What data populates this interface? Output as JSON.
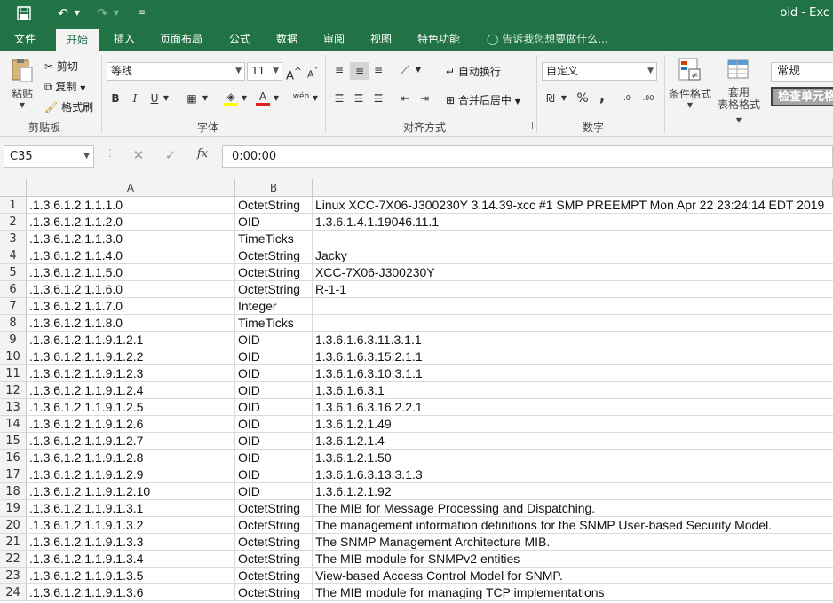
{
  "app": {
    "title": "oid - Exc",
    "accent_color": "#217346",
    "quick_access": [
      "save-icon",
      "undo-icon",
      "redo-icon",
      "customize-icon"
    ]
  },
  "tabs": [
    "文件",
    "开始",
    "插入",
    "页面布局",
    "公式",
    "数据",
    "审阅",
    "视图",
    "特色功能"
  ],
  "active_tab": "开始",
  "tell_me": "告诉我您想要做什么...",
  "ribbon": {
    "clipboard": {
      "paste": "粘贴",
      "cut": "剪切",
      "copy": "复制",
      "format_painter": "格式刷",
      "label": "剪贴板"
    },
    "font": {
      "name": "等线",
      "size": "11",
      "bold": "B",
      "italic": "I",
      "underline": "U",
      "grow": "A",
      "shrink": "A",
      "phonetic": "wén",
      "label": "字体"
    },
    "alignment": {
      "wrap": "自动换行",
      "merge": "合并后居中",
      "label": "对齐方式"
    },
    "number": {
      "format": "自定义",
      "percent": "%",
      "comma": ",",
      "label": "数字"
    },
    "styles": {
      "conditional": "条件格式",
      "table_line1": "套用",
      "table_line2": "表格格式",
      "style_normal": "常规",
      "style_check": "检查单元格"
    }
  },
  "formula_bar": {
    "name_box": "C35",
    "cancel": "✕",
    "enter": "✓",
    "fx": "fx",
    "content": "0:00:00"
  },
  "columns": [
    "A",
    "B"
  ],
  "rows": [
    {
      "num": "1",
      "a": ".1.3.6.1.2.1.1.1.0",
      "b": "OctetString",
      "c": "Linux XCC-7X06-J300230Y 3.14.39-xcc #1 SMP PREEMPT Mon Apr 22 23:24:14 EDT 2019"
    },
    {
      "num": "2",
      "a": ".1.3.6.1.2.1.1.2.0",
      "b": "OID",
      "c": "1.3.6.1.4.1.19046.11.1"
    },
    {
      "num": "3",
      "a": ".1.3.6.1.2.1.1.3.0",
      "b": "TimeTicks",
      "c": ""
    },
    {
      "num": "4",
      "a": ".1.3.6.1.2.1.1.4.0",
      "b": "OctetString",
      "c": "Jacky"
    },
    {
      "num": "5",
      "a": ".1.3.6.1.2.1.1.5.0",
      "b": "OctetString",
      "c": "XCC-7X06-J300230Y"
    },
    {
      "num": "6",
      "a": ".1.3.6.1.2.1.1.6.0",
      "b": "OctetString",
      "c": "R-1-1"
    },
    {
      "num": "7",
      "a": ".1.3.6.1.2.1.1.7.0",
      "b": "Integer",
      "c": ""
    },
    {
      "num": "8",
      "a": ".1.3.6.1.2.1.1.8.0",
      "b": "TimeTicks",
      "c": ""
    },
    {
      "num": "9",
      "a": ".1.3.6.1.2.1.1.9.1.2.1",
      "b": "OID",
      "c": "1.3.6.1.6.3.11.3.1.1"
    },
    {
      "num": "10",
      "a": ".1.3.6.1.2.1.1.9.1.2.2",
      "b": "OID",
      "c": "1.3.6.1.6.3.15.2.1.1"
    },
    {
      "num": "11",
      "a": ".1.3.6.1.2.1.1.9.1.2.3",
      "b": "OID",
      "c": "1.3.6.1.6.3.10.3.1.1"
    },
    {
      "num": "12",
      "a": ".1.3.6.1.2.1.1.9.1.2.4",
      "b": "OID",
      "c": "1.3.6.1.6.3.1"
    },
    {
      "num": "13",
      "a": ".1.3.6.1.2.1.1.9.1.2.5",
      "b": "OID",
      "c": "1.3.6.1.6.3.16.2.2.1"
    },
    {
      "num": "14",
      "a": ".1.3.6.1.2.1.1.9.1.2.6",
      "b": "OID",
      "c": "1.3.6.1.2.1.49"
    },
    {
      "num": "15",
      "a": ".1.3.6.1.2.1.1.9.1.2.7",
      "b": "OID",
      "c": "1.3.6.1.2.1.4"
    },
    {
      "num": "16",
      "a": ".1.3.6.1.2.1.1.9.1.2.8",
      "b": "OID",
      "c": "1.3.6.1.2.1.50"
    },
    {
      "num": "17",
      "a": ".1.3.6.1.2.1.1.9.1.2.9",
      "b": "OID",
      "c": "1.3.6.1.6.3.13.3.1.3"
    },
    {
      "num": "18",
      "a": ".1.3.6.1.2.1.1.9.1.2.10",
      "b": "OID",
      "c": "1.3.6.1.2.1.92"
    },
    {
      "num": "19",
      "a": ".1.3.6.1.2.1.1.9.1.3.1",
      "b": "OctetString",
      "c": "The MIB for Message Processing and Dispatching."
    },
    {
      "num": "20",
      "a": ".1.3.6.1.2.1.1.9.1.3.2",
      "b": "OctetString",
      "c": "The management information definitions for the SNMP User-based Security Model."
    },
    {
      "num": "21",
      "a": ".1.3.6.1.2.1.1.9.1.3.3",
      "b": "OctetString",
      "c": "The SNMP Management Architecture MIB."
    },
    {
      "num": "22",
      "a": ".1.3.6.1.2.1.1.9.1.3.4",
      "b": "OctetString",
      "c": "The MIB module for SNMPv2 entities"
    },
    {
      "num": "23",
      "a": ".1.3.6.1.2.1.1.9.1.3.5",
      "b": "OctetString",
      "c": "View-based Access Control Model for SNMP."
    },
    {
      "num": "24",
      "a": ".1.3.6.1.2.1.1.9.1.3.6",
      "b": "OctetString",
      "c": "The MIB module for managing TCP implementations"
    }
  ]
}
